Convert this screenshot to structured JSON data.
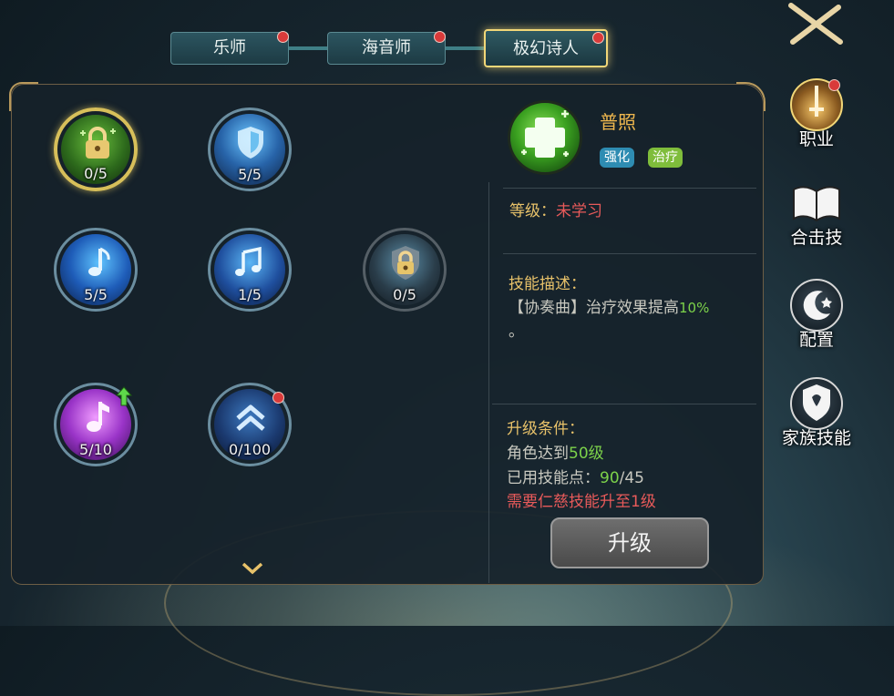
{
  "tabs": [
    {
      "label": "乐师",
      "active": false,
      "has_dot": true
    },
    {
      "label": "海音师",
      "active": false,
      "has_dot": true
    },
    {
      "label": "极幻诗人",
      "active": true,
      "has_dot": true
    }
  ],
  "skills": [
    {
      "level": "0/5",
      "icon": "lock-heal-icon"
    },
    {
      "level": "5/5",
      "icon": "shield-icon"
    },
    {
      "level": "5/5",
      "icon": "music-note-icon"
    },
    {
      "level": "1/5",
      "icon": "music-notes-icon"
    },
    {
      "level": "0/5",
      "icon": "lock-shield-icon"
    },
    {
      "level": "5/10",
      "icon": "purple-note-icon",
      "upgrade_arrow": true
    },
    {
      "level": "0/100",
      "icon": "chevron-up-icon",
      "has_dot": true
    }
  ],
  "detail": {
    "name": "普照",
    "tags": [
      "强化",
      "治疗"
    ],
    "level_label": "等级：",
    "level_value": "未学习",
    "desc_title": "技能描述：",
    "desc_text": "【协奏曲】治疗效果提高",
    "desc_value": "10%",
    "desc_tail": "。",
    "cond_title": "升级条件：",
    "cond_line1_prefix": "角色达到",
    "cond_line1_value": "50级",
    "cond_line2_prefix": "已用技能点：",
    "cond_line2_value": "90",
    "cond_line2_suffix": "/45",
    "cond_line3": "需要仁慈技能升至1级",
    "upgrade_button": "升级"
  },
  "sidebar": [
    {
      "label": "职业",
      "icon": "sword-icon",
      "has_dot": true
    },
    {
      "label": "合击技",
      "icon": "book-icon"
    },
    {
      "label": "配置",
      "icon": "moon-icon"
    },
    {
      "label": "家族技能",
      "icon": "family-crest-icon"
    }
  ],
  "colors": {
    "gold": "#f0b84e",
    "green": "#7cd24a",
    "red": "#e85a5a",
    "tag_blue": "#2f8fb5",
    "tag_green": "#7fbf3a"
  }
}
